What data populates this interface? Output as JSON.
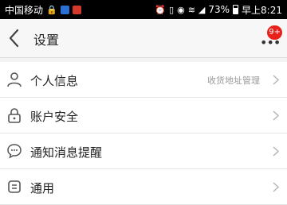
{
  "status_bar": {
    "carrier": "中国移动",
    "battery_percent": "73%",
    "time": "早上8:21",
    "icons": [
      "lock-icon",
      "app-badge-icon",
      "app-badge-icon",
      "alarm-icon",
      "vibrate-icon",
      "eye-icon",
      "wifi-icon",
      "signal-icon",
      "battery-icon"
    ]
  },
  "header": {
    "title": "设置",
    "notification_count": "9+",
    "colors": {
      "badge": "#e8221b"
    }
  },
  "settings": {
    "items": [
      {
        "icon": "person-icon",
        "label": "个人信息",
        "hint": "收货地址管理"
      },
      {
        "icon": "lock-icon",
        "label": "账户安全"
      },
      {
        "icon": "chat-bubble-icon",
        "label": "通知消息提醒"
      },
      {
        "icon": "general-icon",
        "label": "通用"
      }
    ]
  }
}
